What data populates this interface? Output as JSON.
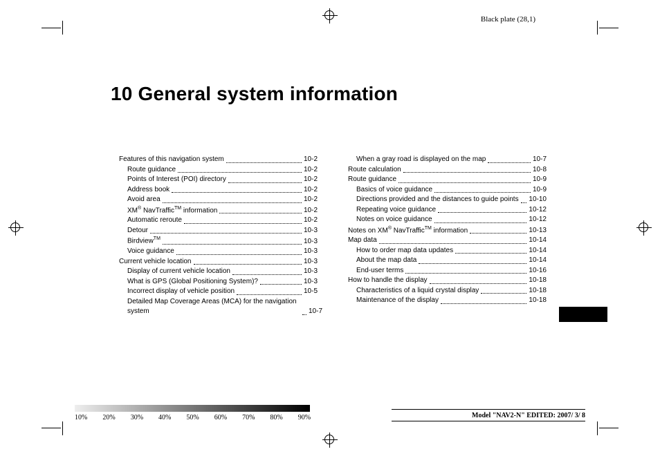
{
  "plate_label": "Black plate (28,1)",
  "chapter_title": "10 General system information",
  "toc": {
    "left": [
      {
        "label": "Features of this navigation system",
        "page": "10-2",
        "indent": false
      },
      {
        "label": "Route guidance",
        "page": "10-2",
        "indent": true
      },
      {
        "label": "Points of Interest (POI) directory",
        "page": "10-2",
        "indent": true
      },
      {
        "label": "Address book",
        "page": "10-2",
        "indent": true
      },
      {
        "label": "Avoid area",
        "page": "10-2",
        "indent": true
      },
      {
        "label_html": "XM<sup class='reg-mark'>®</sup> NavTraffic<sup class='tm'>TM</sup> information",
        "page": "10-2",
        "indent": true
      },
      {
        "label": "Automatic reroute",
        "page": "10-2",
        "indent": true
      },
      {
        "label": "Detour",
        "page": "10-3",
        "indent": true
      },
      {
        "label_html": "Birdview<sup class='tm'>TM</sup>",
        "page": "10-3",
        "indent": true
      },
      {
        "label": "Voice guidance",
        "page": "10-3",
        "indent": true
      },
      {
        "label": "Current vehicle location",
        "page": "10-3",
        "indent": false
      },
      {
        "label": "Display of current vehicle location",
        "page": "10-3",
        "indent": true
      },
      {
        "label": "What is GPS (Global Positioning System)?",
        "page": "10-3",
        "indent": true
      },
      {
        "label": "Incorrect display of vehicle position",
        "page": "10-5",
        "indent": true
      },
      {
        "label": "Detailed Map Coverage Areas (MCA) for the navigation system",
        "page": "10-7",
        "indent": true,
        "wrap": true
      }
    ],
    "right": [
      {
        "label": "When a gray road is displayed on the map",
        "page": "10-7",
        "indent": true
      },
      {
        "label": "Route calculation",
        "page": "10-8",
        "indent": false
      },
      {
        "label": "Route guidance",
        "page": "10-9",
        "indent": false
      },
      {
        "label": "Basics of voice guidance",
        "page": "10-9",
        "indent": true
      },
      {
        "label": "Directions provided and the distances to guide points",
        "page": "10-10",
        "indent": true,
        "wrap": true
      },
      {
        "label": "Repeating voice guidance",
        "page": "10-12",
        "indent": true
      },
      {
        "label": "Notes on voice guidance",
        "page": "10-12",
        "indent": true
      },
      {
        "label_html": "Notes on XM<sup class='reg-mark'>®</sup> NavTraffic<sup class='tm'>TM</sup> information",
        "page": "10-13",
        "indent": false
      },
      {
        "label": "Map data",
        "page": "10-14",
        "indent": false
      },
      {
        "label": "How to order map data updates",
        "page": "10-14",
        "indent": true
      },
      {
        "label": "About the map data",
        "page": "10-14",
        "indent": true
      },
      {
        "label": "End-user terms",
        "page": "10-16",
        "indent": true
      },
      {
        "label": "How to handle the display",
        "page": "10-18",
        "indent": false
      },
      {
        "label": "Characteristics of a liquid crystal display",
        "page": "10-18",
        "indent": true
      },
      {
        "label": "Maintenance of the display",
        "page": "10-18",
        "indent": true
      }
    ]
  },
  "scale": [
    "10%",
    "20%",
    "30%",
    "40%",
    "50%",
    "60%",
    "70%",
    "80%",
    "90%"
  ],
  "model_line": "Model \"NAV2-N\" EDITED: 2007/ 3/ 8"
}
